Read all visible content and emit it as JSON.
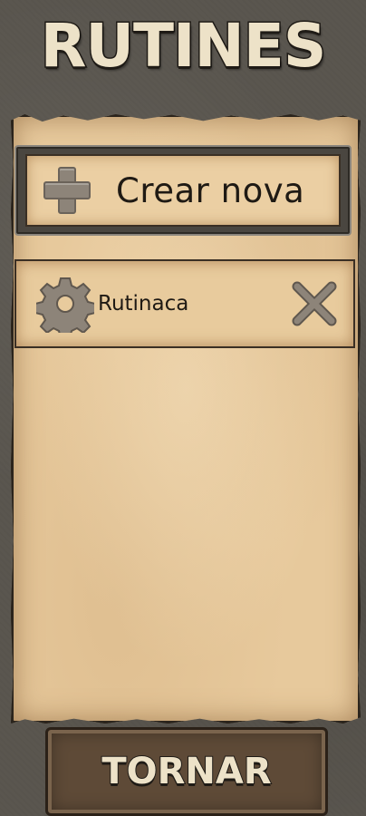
{
  "header": {
    "title": "RUTINES"
  },
  "create_button": {
    "label": "Crear nova",
    "icon": "plus-icon"
  },
  "routines": [
    {
      "name": "Rutinaca",
      "settings_icon": "gear-icon",
      "delete_icon": "close-icon"
    }
  ],
  "footer": {
    "back_label": "TORNAR"
  },
  "colors": {
    "background": "#5a564f",
    "parchment": "#e7c99c",
    "title_text": "#ede2c8",
    "dark_outline": "#1f1b16",
    "button_wood": "#5e4a37",
    "icon_grey": "#8d8479"
  }
}
